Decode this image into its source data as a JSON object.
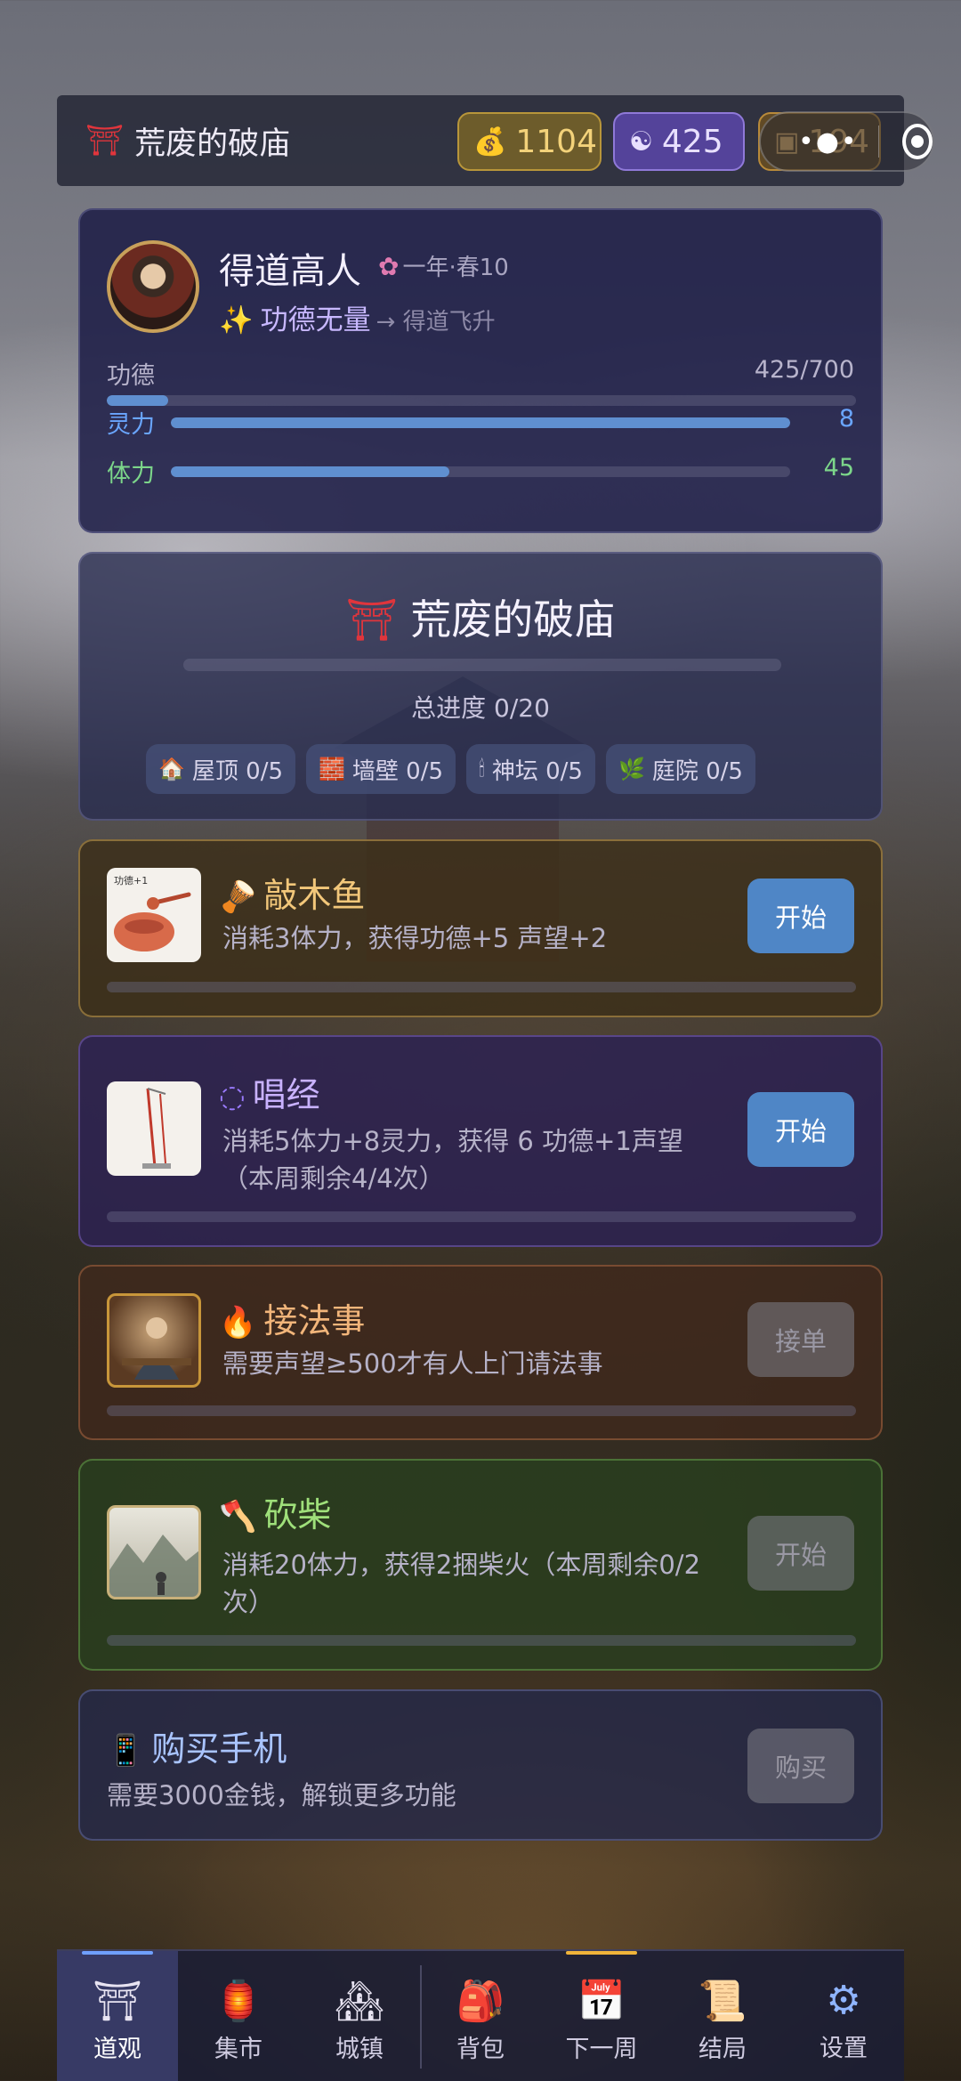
{
  "header": {
    "location_icon": "torii-icon",
    "location_title": "荒废的破庙",
    "currencies": {
      "gold": {
        "icon": "money-bag-icon",
        "value": "1104"
      },
      "yinyang": {
        "icon": "yin-yang-icon",
        "value": "425"
      },
      "box": {
        "icon": "box-icon",
        "value": "194"
      }
    },
    "miniprogram_capsule": {
      "menu_icon": "more-dots-icon",
      "close_icon": "target-icon"
    }
  },
  "profile": {
    "name": "得道高人",
    "season_icon": "flower-icon",
    "season": "一年·春10",
    "title_icon": "sparkles-icon",
    "title": "功德无量",
    "next_title": "→ 得道飞升",
    "stats": [
      {
        "label": "功德",
        "value": "425/700",
        "fill": 0.082,
        "color": "#b8b4cc"
      },
      {
        "label": "灵力",
        "value": "8",
        "fill": 1.0,
        "color": "#6aa6ff"
      },
      {
        "label": "体力",
        "value": "45",
        "fill": 0.45,
        "color": "#7cd68a"
      }
    ]
  },
  "temple": {
    "icon": "torii-icon",
    "title": "荒废的破庙",
    "progress_fill": 0.0,
    "total": "总进度 0/20",
    "parts": [
      {
        "icon": "house-icon",
        "label": "屋顶 0/5"
      },
      {
        "icon": "brick-icon",
        "label": "墙壁 0/5"
      },
      {
        "icon": "candle-icon",
        "label": "神坛 0/5"
      },
      {
        "icon": "herb-icon",
        "label": "庭院 0/5"
      }
    ]
  },
  "activities": [
    {
      "icon": "drum-icon",
      "title": "敲木鱼",
      "desc": "消耗3体力，获得功德+5 声望+2",
      "button": "开始",
      "enabled": true,
      "title_color": "#f2c77a",
      "thumb_label": "功德+1"
    },
    {
      "icon": "prayer-beads-icon",
      "title": "唱经",
      "desc": "消耗5体力+8灵力，获得 6 功德+1声望（本周剩余4/4次）",
      "button": "开始",
      "enabled": true,
      "title_color": "#c9b2ff"
    },
    {
      "icon": "fire-icon",
      "title": "接法事",
      "desc": "需要声望≥500才有人上门请法事",
      "button": "接单",
      "enabled": false,
      "title_color": "#f2b57a"
    },
    {
      "icon": "axe-icon",
      "title": "砍柴",
      "desc": "消耗20体力，获得2捆柴火（本周剩余0/2次）",
      "button": "开始",
      "enabled": false,
      "title_color": "#9fe07a"
    },
    {
      "icon": "phone-icon",
      "title": "购买手机",
      "desc": "需要3000金钱，解锁更多功能",
      "button": "购买",
      "enabled": false,
      "title_color": "#a9c4ff"
    }
  ],
  "nav": [
    {
      "icon": "temple-icon",
      "label": "道观"
    },
    {
      "icon": "market-icon",
      "label": "集市"
    },
    {
      "icon": "town-icon",
      "label": "城镇"
    },
    {
      "icon": "backpack-icon",
      "label": "背包"
    },
    {
      "icon": "calendar-icon",
      "label": "下一周"
    },
    {
      "icon": "scroll-icon",
      "label": "结局"
    },
    {
      "icon": "gear-icon",
      "label": "设置"
    }
  ]
}
